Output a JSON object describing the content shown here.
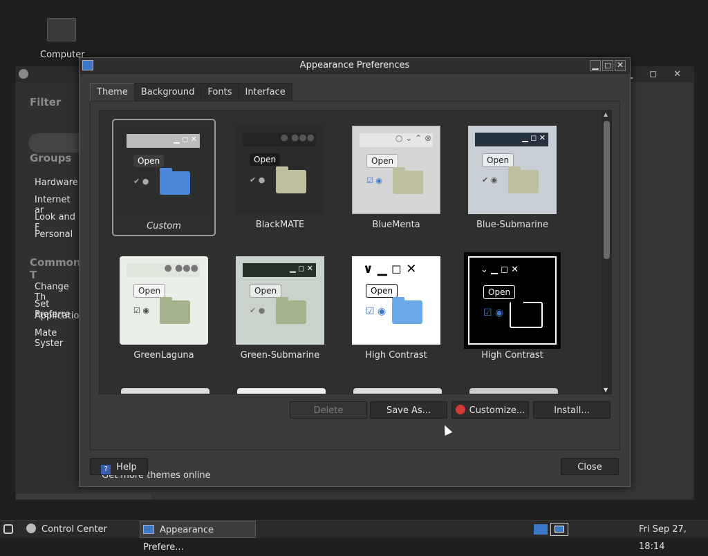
{
  "desktop": {
    "computer_label": "Computer"
  },
  "control_center": {
    "filter_heading": "Filter",
    "groups_heading": "Groups",
    "groups": [
      "Hardware",
      "Internet ar",
      "Look and F",
      "Personal"
    ],
    "common_heading": "Common T",
    "common": [
      "Change Th",
      "Set Preferre",
      "Applicatio",
      "Mate Syster"
    ]
  },
  "dialog": {
    "title": "Appearance Preferences",
    "tabs": [
      "Theme",
      "Background",
      "Fonts",
      "Interface"
    ],
    "active_tab": "Theme",
    "themes": [
      {
        "name": "Custom",
        "selected": true
      },
      {
        "name": "BlackMATE"
      },
      {
        "name": "BlueMenta"
      },
      {
        "name": "Blue-Submarine"
      },
      {
        "name": "GreenLaguna"
      },
      {
        "name": "Green-Submarine"
      },
      {
        "name": "High Contrast"
      },
      {
        "name": "High Contrast"
      }
    ],
    "thumb_open_text": "Open",
    "buttons": {
      "delete": "Delete",
      "save_as": "Save As...",
      "customize": "Customize...",
      "install": "Install..."
    },
    "more_link": "Get more themes online",
    "help": "Help",
    "close": "Close"
  },
  "taskbar": {
    "items": [
      "Control Center",
      "Appearance Prefere..."
    ],
    "clock": "Fri Sep 27, 18:14"
  },
  "colors": {
    "accent_blue": "#3c78c8",
    "dialog_bg": "#3b3b3b"
  }
}
